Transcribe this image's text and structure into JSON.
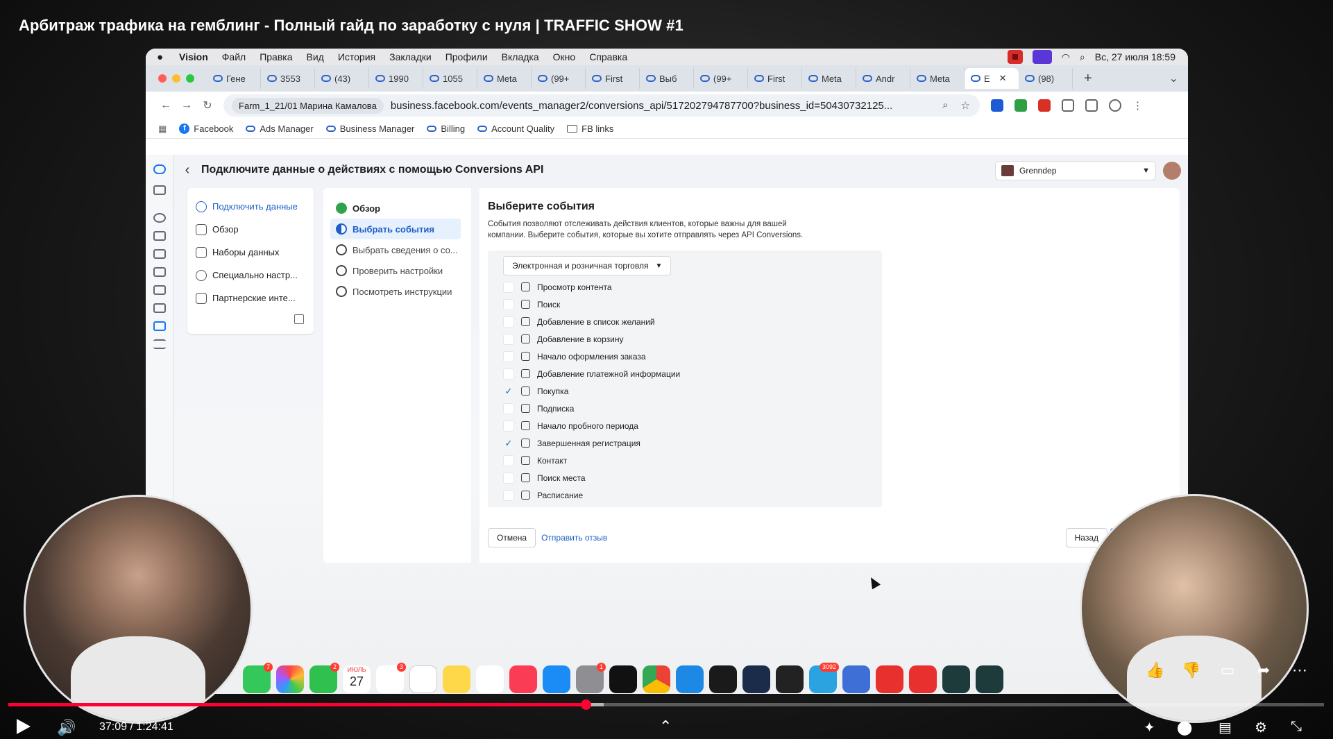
{
  "video": {
    "title": "Арбитраж трафика на гемблинг - Полный гайд по заработку с нуля | TRAFFIC SHOW #1",
    "time": "37:09 / 1:24:41",
    "progress_fraction": 0.439
  },
  "macos": {
    "menu": [
      "Vision",
      "Файл",
      "Правка",
      "Вид",
      "История",
      "Закладки",
      "Профили",
      "Вкладка",
      "Окно",
      "Справка"
    ],
    "clock": "Вс, 27 июля  18:59"
  },
  "browser": {
    "tabs": [
      "Гене",
      "3553",
      "(43)",
      "1990",
      "1055",
      "Meta",
      "(99+",
      "First",
      "Выб",
      "(99+",
      "First",
      "Meta",
      "Andr",
      "Meta",
      "E",
      "(98)"
    ],
    "profile_chip": "Farm_1_21/01 Марина Камалова",
    "url": "business.facebook.com/events_manager2/conversions_api/517202794787700?business_id=50430732125...",
    "bookmarks": [
      "Facebook",
      "Ads Manager",
      "Business Manager",
      "Billing",
      "Account Quality",
      "FB links"
    ]
  },
  "page": {
    "title": "Подключите данные о действиях с помощью Conversions API",
    "account": "Grenndep",
    "sidenav": [
      "Подключить данные",
      "Обзор",
      "Наборы данных",
      "Специально настр...",
      "Партнерские инте..."
    ],
    "steps": [
      "Обзор",
      "Выбрать события",
      "Выбрать сведения о со...",
      "Проверить настройки",
      "Посмотреть инструкции"
    ],
    "heading": "Выберите события",
    "description": "События позволяют отслеживать действия клиентов, которые важны для вашей компании. Выберите события, которые вы хотите отправлять через API Conversions.",
    "category": "Электронная и розничная торговля",
    "events": [
      {
        "label": "Просмотр контента",
        "checked": false
      },
      {
        "label": "Поиск",
        "checked": false
      },
      {
        "label": "Добавление в список желаний",
        "checked": false
      },
      {
        "label": "Добавление в корзину",
        "checked": false
      },
      {
        "label": "Начало оформления заказа",
        "checked": false
      },
      {
        "label": "Добавление платежной информации",
        "checked": false
      },
      {
        "label": "Покупка",
        "checked": true
      },
      {
        "label": "Подписка",
        "checked": false
      },
      {
        "label": "Начало пробного периода",
        "checked": false
      },
      {
        "label": "Завершенная регистрация",
        "checked": true
      },
      {
        "label": "Контакт",
        "checked": false
      },
      {
        "label": "Поиск места",
        "checked": false
      },
      {
        "label": "Расписание",
        "checked": false
      }
    ],
    "cancel": "Отмена",
    "feedback": "Отправить отзыв",
    "back": "Назад"
  },
  "dock": {
    "calendar_month": "ИЮЛЬ",
    "calendar_day": "27",
    "badges": [
      "7",
      "2",
      "3",
      "1",
      "3092"
    ]
  }
}
